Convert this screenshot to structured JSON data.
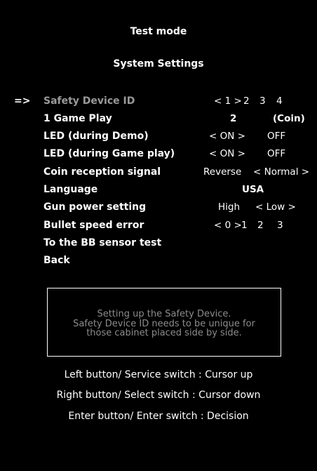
{
  "header": {
    "title": "Test mode",
    "subtitle": "System Settings"
  },
  "cursor": "=>",
  "settings": [
    {
      "label": "Safety Device ID",
      "options": [
        "< 1 >",
        "2",
        "3",
        "4"
      ],
      "selected": "1"
    },
    {
      "label": "1 Game Play",
      "value": "2",
      "unit": "(Coin)"
    },
    {
      "label": "LED (during Demo)",
      "options": [
        "< ON >",
        "OFF"
      ],
      "selected": "ON"
    },
    {
      "label": "LED (during Game play)",
      "options": [
        "< ON >",
        "OFF"
      ],
      "selected": "ON"
    },
    {
      "label": "Coin reception signal",
      "options": [
        "Reverse",
        "< Normal >"
      ],
      "selected": "Normal"
    },
    {
      "label": "Language",
      "value": "USA"
    },
    {
      "label": "Gun power setting",
      "options": [
        "High",
        "< Low >"
      ],
      "selected": "Low"
    },
    {
      "label": "Bullet speed error",
      "options": [
        "< 0 >",
        "1",
        "2",
        "3"
      ],
      "selected": "0"
    },
    {
      "label": "To the BB sensor test"
    },
    {
      "label": "Back"
    }
  ],
  "info": {
    "lines": [
      "Setting up the Safety Device.",
      "Safety Device ID needs to be unique for",
      "those cabinet placed side by side."
    ]
  },
  "help": [
    "Left button/ Service switch : Cursor up",
    "Right button/ Select switch : Cursor down",
    "Enter button/ Enter switch : Decision"
  ],
  "colors": {
    "background": "#000000",
    "text": "#ffffff",
    "selected_label": "#9a9a9a",
    "info_text": "#8c8c8c"
  }
}
